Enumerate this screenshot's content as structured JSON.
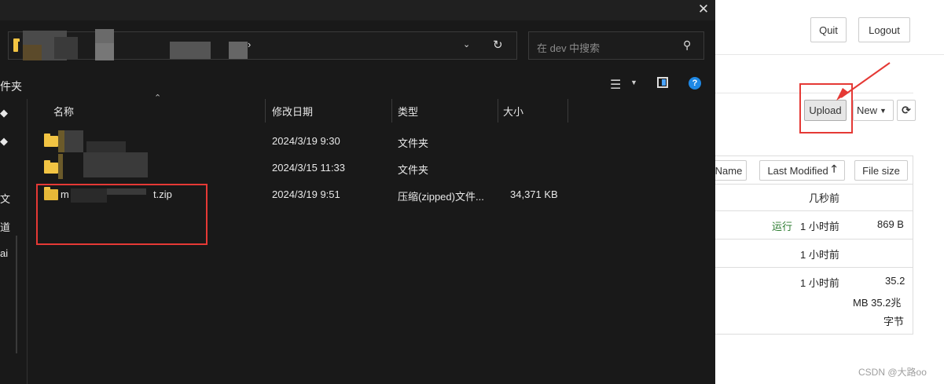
{
  "background": {
    "quit_label": "Quit",
    "logout_label": "Logout",
    "upload_label": "Upload",
    "new_label": "New",
    "refresh_icon": "refresh-icon",
    "columns": {
      "name": "Name",
      "last_modified": "Last Modified",
      "file_size": "File size"
    },
    "rows": [
      {
        "status": "",
        "modified": "几秒前",
        "size": ""
      },
      {
        "status": "运行",
        "modified": "1 小时前",
        "size": "869 B"
      },
      {
        "status": "",
        "modified": "1 小时前",
        "size": ""
      },
      {
        "status": "",
        "modified": "1 小时前",
        "size_line1": "35.2",
        "size_line2": "MB 35.2兆",
        "size_line3": "字节"
      }
    ],
    "watermark": "CSDN @大路oo",
    "status_color": "#2e7d32",
    "highlight_color": "#e53935"
  },
  "dialog": {
    "search_placeholder": "在 dev 中搜索",
    "toolbar_left_label": "件夹",
    "nav_glyphs": [
      "文",
      "道",
      "ai"
    ],
    "columns": {
      "name": "名称",
      "modified": "修改日期",
      "type": "类型",
      "size": "大小"
    },
    "files": [
      {
        "name": "",
        "modified": "2024/3/19 9:30",
        "type": "文件夹",
        "size": ""
      },
      {
        "name": "",
        "modified": "2024/3/15 11:33",
        "type": "文件夹",
        "size": ""
      },
      {
        "name_start": "m",
        "name_end": "t.zip",
        "modified": "2024/3/19 9:51",
        "type": "压缩(zipped)文件...",
        "size": "34,371 KB"
      }
    ]
  }
}
